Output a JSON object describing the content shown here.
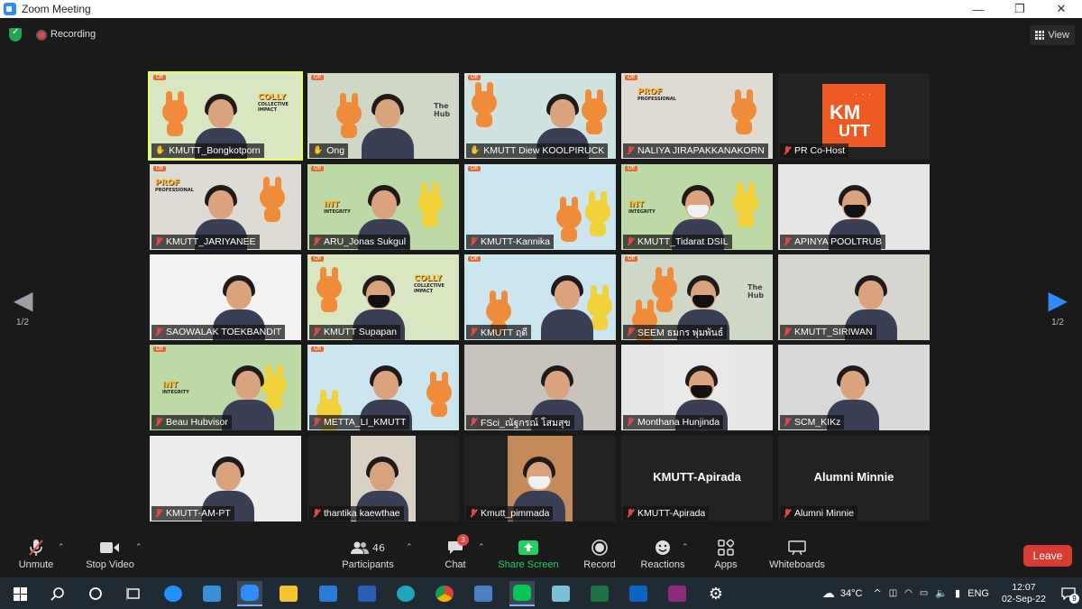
{
  "window": {
    "title": "Zoom Meeting",
    "controls": [
      "—",
      "❐",
      "✕"
    ]
  },
  "topbar": {
    "recording_label": "Recording",
    "view_label": "View"
  },
  "pagination": {
    "left": "1/2",
    "right": "1/2"
  },
  "tiles": [
    {
      "name": "KMUTT_Bongkotporn",
      "muted": false,
      "pinned": true,
      "speaking": true,
      "bg": "#d8e7c2"
    },
    {
      "name": "Ong",
      "muted": false,
      "pinned": true,
      "bg": "#cfd8c6"
    },
    {
      "name": "KMUTT Diew KOOLPIRUCK",
      "muted": false,
      "pinned": true,
      "bg": "#cfe3e0"
    },
    {
      "name": "NALIYA JIRAPAKKANAKORN",
      "muted": true,
      "bg": "#dedad4"
    },
    {
      "name": "PR Co-Host",
      "muted": true,
      "bg": "#222222"
    },
    {
      "name": "KMUTT_JARIYANEE",
      "muted": true,
      "bg": "#dedad4"
    },
    {
      "name": "ARU_Jonas Sukgul",
      "muted": true,
      "bg": "#bcd9a6"
    },
    {
      "name": "KMUTT-Kannika",
      "muted": true,
      "bg": "#cbe6ef"
    },
    {
      "name": "KMUTT_Tidarat DSIL",
      "muted": true,
      "bg": "#bcd9a6"
    },
    {
      "name": "APINYA POOLTRUB",
      "muted": true,
      "bg": "#e6e6e6"
    },
    {
      "name": "SAOWALAK TOEKBANDIT",
      "muted": true,
      "bg": "#f2f2f2"
    },
    {
      "name": "KMUTT Supapan",
      "muted": true,
      "bg": "#d8e7c2"
    },
    {
      "name": "KMUTT ฤดี",
      "muted": true,
      "bg": "#cbe6ef"
    },
    {
      "name": "SEEM ธมกร พุ่มพันธ์",
      "muted": true,
      "bg": "#cfd8c6"
    },
    {
      "name": "KMUTT_SIRIWAN",
      "muted": true,
      "bg": "#d6d6d0"
    },
    {
      "name": "Beau Hubvisor",
      "muted": true,
      "bg": "#bcd9a6"
    },
    {
      "name": "METTA_LI_KMUTT",
      "muted": true,
      "bg": "#cbe6ef"
    },
    {
      "name": "FSci_ณัฐกรณ์ โสมสุข",
      "muted": true,
      "bg": "#c9c3bd"
    },
    {
      "name": "Monthana Hunjinda",
      "muted": true,
      "bg": "#e6e6e6"
    },
    {
      "name": "SCM_KIKz",
      "muted": true,
      "bg": "#d9d9d9"
    },
    {
      "name": "KMUTT-AM-PT",
      "muted": true,
      "bg": "#ececec"
    },
    {
      "name": "thantika kaewthae",
      "muted": true,
      "bg": "#222222"
    },
    {
      "name": "Kmutt_pimmada",
      "muted": true,
      "bg": "#222222"
    },
    {
      "name": "KMUTT-Apirada",
      "muted": true,
      "bg": "#222222",
      "video_off": true
    },
    {
      "name": "Alumni Minnie",
      "muted": true,
      "bg": "#222222",
      "video_off": true
    }
  ],
  "signs": {
    "colly": "COLLY",
    "collective": "COLLECTIVE IMPACT",
    "prof": "PROF",
    "professional": "PROFESSIONAL",
    "int": "INT",
    "integrity": "INTEGRITY",
    "hub": "The Hub",
    "off": "Off"
  },
  "pr_logo": {
    "line1": "KM",
    "line2": "UTT"
  },
  "toolbar": {
    "unmute": "Unmute",
    "stop_video": "Stop Video",
    "participants": "Participants",
    "participants_count": "46",
    "chat": "Chat",
    "chat_badge": "3",
    "share_screen": "Share Screen",
    "record": "Record",
    "reactions": "Reactions",
    "apps": "Apps",
    "whiteboards": "Whiteboards",
    "leave": "Leave"
  },
  "taskbar": {
    "temperature": "34°C",
    "language": "ENG",
    "time": "12:07",
    "date": "02-Sep-22",
    "notifications": "9"
  },
  "colors": {
    "accent": "#2d8cff",
    "leave": "#d73d32",
    "share": "#23d160",
    "muted": "#e04848",
    "speaking": "#e4ff5a"
  }
}
